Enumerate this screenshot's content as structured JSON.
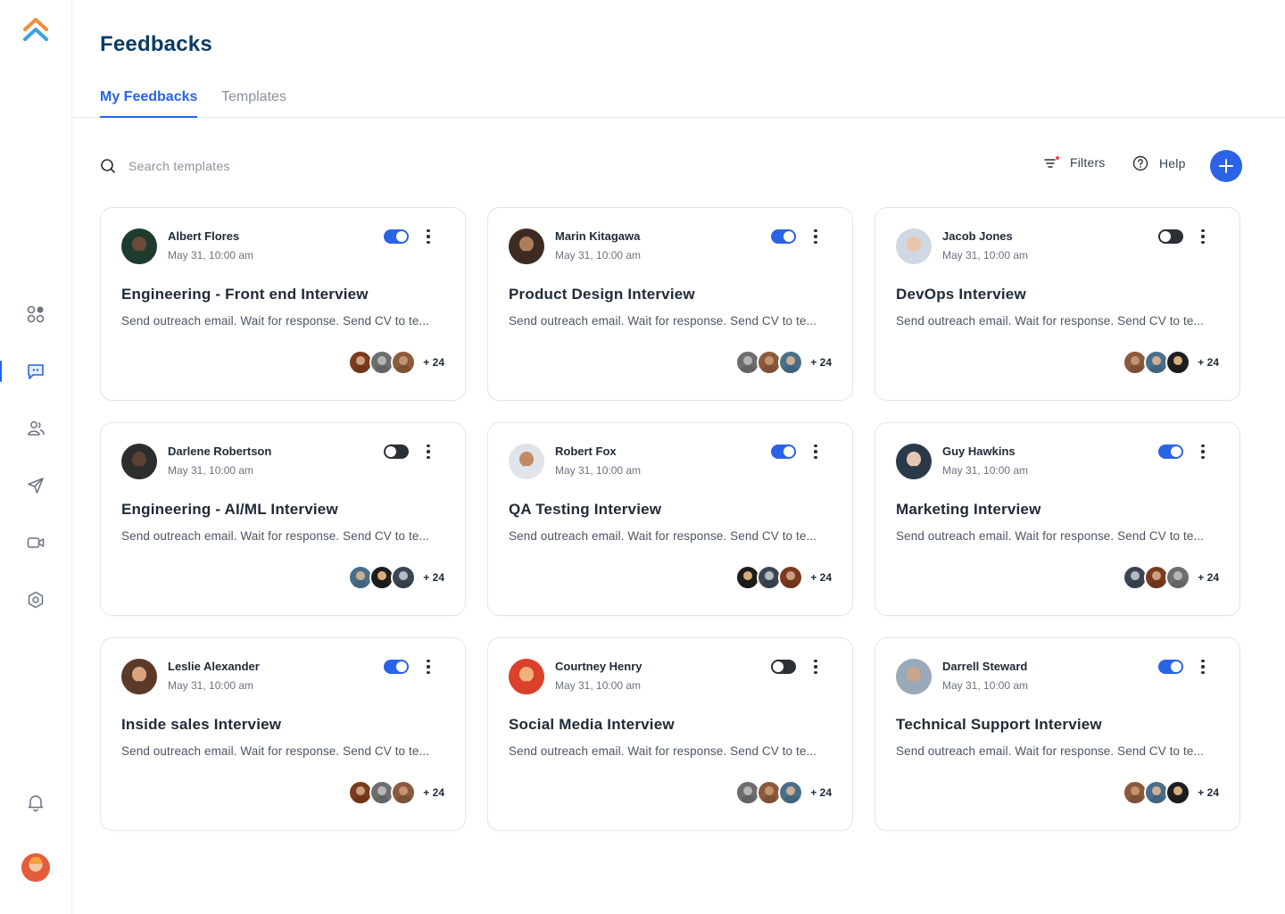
{
  "page": {
    "title": "Feedbacks",
    "tabs": [
      {
        "label": "My Feedbacks",
        "active": true
      },
      {
        "label": "Templates",
        "active": false
      }
    ]
  },
  "toolbar": {
    "search_placeholder": "Search templates",
    "filters_label": "Filters",
    "help_label": "Help",
    "add_icon": "plus-icon"
  },
  "sidebar": {
    "items": [
      {
        "icon": "dashboard-icon",
        "active": false
      },
      {
        "icon": "chat-icon",
        "active": true
      },
      {
        "icon": "users-icon",
        "active": false
      },
      {
        "icon": "send-icon",
        "active": false
      },
      {
        "icon": "video-icon",
        "active": false
      },
      {
        "icon": "settings-icon",
        "active": false
      }
    ],
    "bottom": [
      {
        "icon": "bell-icon"
      }
    ]
  },
  "colors": {
    "accent": "#2a63e5",
    "title": "#0b3b63",
    "toggle_off": "#2b2f36"
  },
  "cards": [
    {
      "owner": "Albert Flores",
      "date": "May 31, 10:00 am",
      "title": "Engineering - Front end Interview",
      "desc": "Send outreach email. Wait for response. Send CV to te...",
      "enabled": true,
      "extra": "+ 24"
    },
    {
      "owner": "Marin Kitagawa",
      "date": "May 31, 10:00 am",
      "title": "Product Design Interview",
      "desc": "Send outreach email. Wait for response. Send CV to te...",
      "enabled": true,
      "extra": "+ 24"
    },
    {
      "owner": "Jacob Jones",
      "date": "May 31, 10:00 am",
      "title": "DevOps Interview",
      "desc": "Send outreach email. Wait for response. Send CV to te...",
      "enabled": false,
      "extra": "+ 24"
    },
    {
      "owner": "Darlene Robertson",
      "date": "May 31, 10:00 am",
      "title": "Engineering - AI/ML Interview",
      "desc": "Send outreach email. Wait for response. Send CV to te...",
      "enabled": false,
      "extra": "+ 24"
    },
    {
      "owner": "Robert Fox",
      "date": "May 31, 10:00 am",
      "title": "QA Testing Interview",
      "desc": "Send outreach email. Wait for response. Send CV to te...",
      "enabled": true,
      "extra": "+ 24"
    },
    {
      "owner": "Guy Hawkins",
      "date": "May 31, 10:00 am",
      "title": "Marketing Interview",
      "desc": "Send outreach email. Wait for response. Send CV to te...",
      "enabled": true,
      "extra": "+ 24"
    },
    {
      "owner": "Leslie Alexander",
      "date": "May 31, 10:00 am",
      "title": "Inside sales Interview",
      "desc": "Send outreach email. Wait for response. Send CV to te...",
      "enabled": true,
      "extra": "+ 24"
    },
    {
      "owner": "Courtney Henry",
      "date": "May 31, 10:00 am",
      "title": "Social Media Interview",
      "desc": "Send outreach email. Wait for response. Send CV to te...",
      "enabled": false,
      "extra": "+ 24"
    },
    {
      "owner": "Darrell Steward",
      "date": "May 31, 10:00 am",
      "title": "Technical Support Interview",
      "desc": "Send outreach email. Wait for response. Send CV to te...",
      "enabled": true,
      "extra": "+ 24"
    }
  ]
}
